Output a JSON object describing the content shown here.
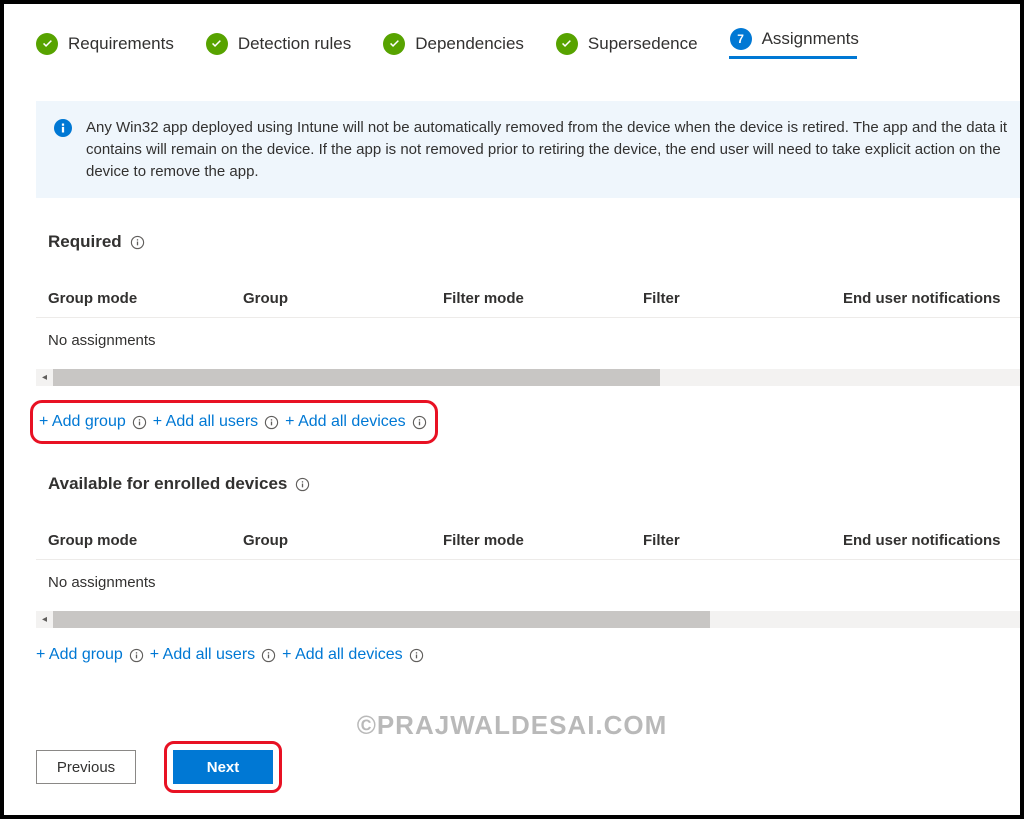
{
  "stepper": {
    "steps": [
      {
        "label": "Requirements",
        "state": "done"
      },
      {
        "label": "Detection rules",
        "state": "done"
      },
      {
        "label": "Dependencies",
        "state": "done"
      },
      {
        "label": "Supersedence",
        "state": "done"
      },
      {
        "label": "Assignments",
        "state": "active",
        "number": "7"
      }
    ]
  },
  "infobar": {
    "text": "Any Win32 app deployed using Intune will not be automatically removed from the device when the device is retired. The app and the data it contains will remain on the device. If the app is not removed prior to retiring the device, the end user will need to take explicit action on the device to remove the app."
  },
  "sections": {
    "required": {
      "title": "Required",
      "columns": [
        "Group mode",
        "Group",
        "Filter mode",
        "Filter",
        "End user notifications"
      ],
      "empty_text": "No assignments",
      "scroll_thumb_pct": 60,
      "links": {
        "add_group": "+ Add group",
        "add_all_users": "+ Add all users",
        "add_all_devices": "+ Add all devices"
      }
    },
    "available": {
      "title": "Available for enrolled devices",
      "columns": [
        "Group mode",
        "Group",
        "Filter mode",
        "Filter",
        "End user notifications"
      ],
      "empty_text": "No assignments",
      "scroll_thumb_pct": 65,
      "links": {
        "add_group": "+ Add group",
        "add_all_users": "+ Add all users",
        "add_all_devices": "+ Add all devices"
      }
    }
  },
  "footer": {
    "previous": "Previous",
    "next": "Next"
  },
  "watermark": "©PRAJWALDESAI.COM"
}
